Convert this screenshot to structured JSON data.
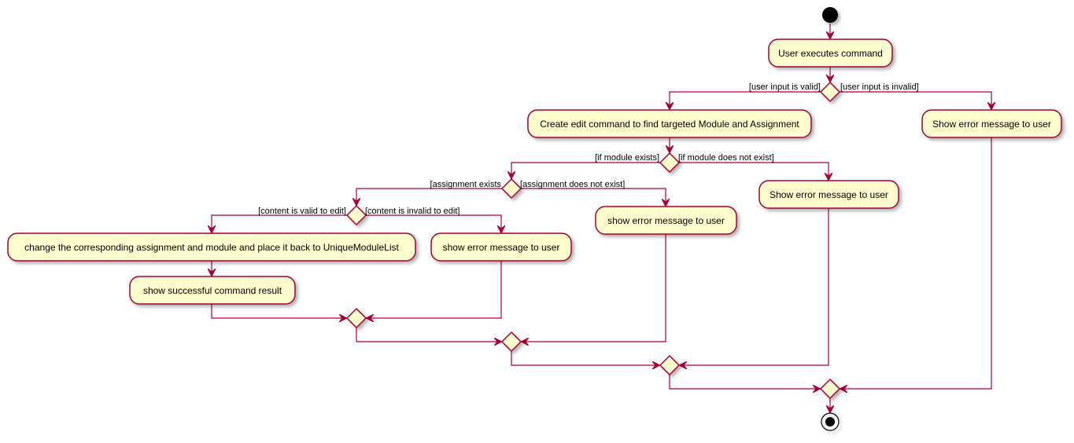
{
  "colors": {
    "node_fill": "#FEFECE",
    "border": "#A80036",
    "start_end": "#000000"
  },
  "activities": {
    "user_executes": "User executes command",
    "create_edit": "Create edit command to find targeted Module and Assignment",
    "error_invalid_input": "Show error message to user",
    "error_no_module": "Show error message to user",
    "error_no_assignment": "show error message to user",
    "change_assignment": "change the corresponding assignment and module and place it back to UniqueModuleList",
    "error_invalid_content": "show error message to user",
    "show_success": "show successful command result"
  },
  "guards": {
    "input_valid": "[user input is valid]",
    "input_invalid": "[user input is invalid]",
    "module_exists": "[if module exists]",
    "module_not_exist": "[if module does not exist]",
    "assignment_exists": "[assignment exists",
    "assignment_not_exist": "[assignment does not exist]",
    "content_valid": "[content is valid to edit]",
    "content_invalid": "[content is invalid to edit]"
  }
}
